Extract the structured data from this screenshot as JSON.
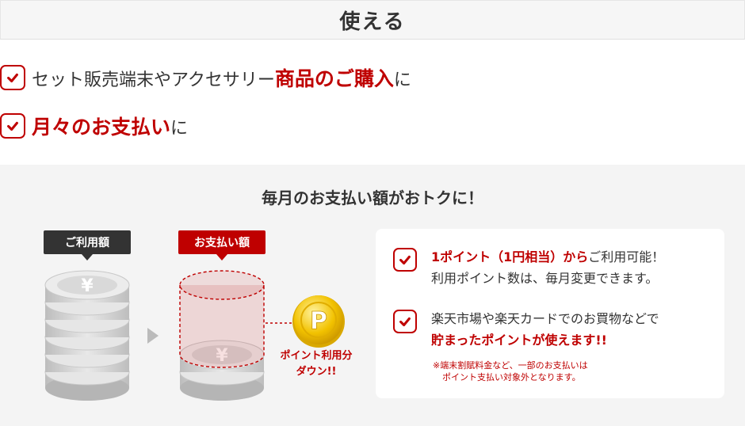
{
  "header": {
    "title": "使える"
  },
  "usage": {
    "row1": {
      "prefix": "セット販売端末やアクセサリー",
      "emphasis": "商品のご購入",
      "suffix": "に"
    },
    "row2": {
      "prefix": "",
      "emphasis": "月々のお支払い",
      "suffix": "に"
    }
  },
  "panel": {
    "title": "毎月のお支払い額がおトクに！",
    "tag_before": "ご利用額",
    "tag_after": "お支払い額",
    "yen_symbol": "¥",
    "point_coin_letter": "P",
    "point_caption_line1": "ポイント利用分",
    "point_caption_line2": "ダウン!!"
  },
  "card": {
    "item1": {
      "line1_red": "1ポイント（1円相当）から",
      "line1_rest": "ご利用可能！",
      "line2": "利用ポイント数は、毎月変更できます。"
    },
    "item2": {
      "line1": "楽天市場や楽天カードでのお買物などで",
      "line2_red": "貯まったポイントが使えます!!"
    },
    "note_line1": "※端末割賦料金など、一部のお支払いは",
    "note_line2": "ポイント支払い対象外となります。"
  },
  "colors": {
    "accent": "#bf0000",
    "dark_tag": "#333333",
    "panel_bg": "#f4f4f4",
    "coin_gold": "#f2c200"
  },
  "icons": {
    "check": "check-icon",
    "arrow": "arrow-right-icon",
    "coin": "point-coin-icon"
  }
}
